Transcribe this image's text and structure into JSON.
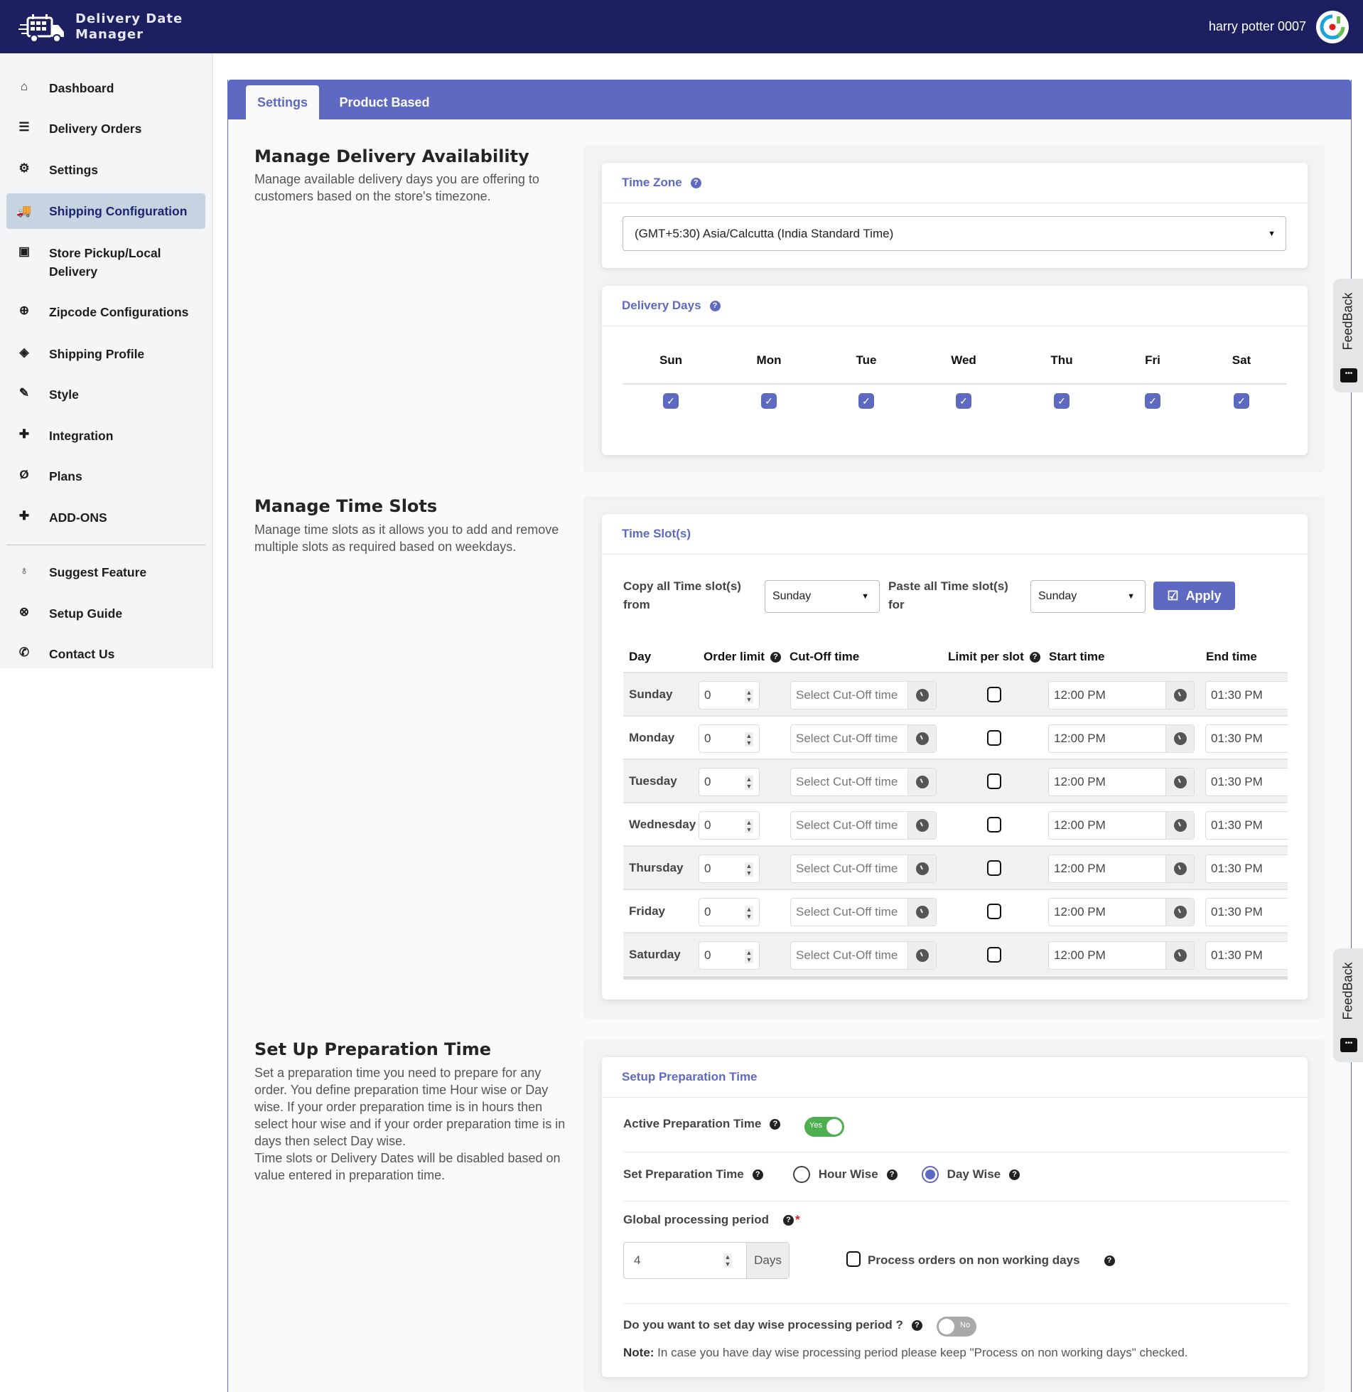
{
  "header": {
    "app_name_line1": "Delivery Date",
    "app_name_line2": "Manager",
    "user_name": "harry potter 0007"
  },
  "sidebar": {
    "items": [
      {
        "label": "Dashboard",
        "icon": "home-icon"
      },
      {
        "label": "Delivery Orders",
        "icon": "list-icon"
      },
      {
        "label": "Settings",
        "icon": "gear-icon"
      },
      {
        "label": "Shipping Configuration",
        "icon": "truck-icon",
        "active": true
      },
      {
        "label": "Store Pickup/Local Delivery",
        "icon": "hand-box-icon"
      },
      {
        "label": "Zipcode Configurations",
        "icon": "map-pin-plus-icon"
      },
      {
        "label": "Shipping Profile",
        "icon": "box-gear-icon"
      },
      {
        "label": "Style",
        "icon": "eyedropper-icon"
      },
      {
        "label": "Integration",
        "icon": "puzzle-icon"
      },
      {
        "label": "Plans",
        "icon": "plans-icon"
      },
      {
        "label": "ADD-ONS",
        "icon": "plus-icon"
      }
    ],
    "secondary_items": [
      {
        "label": "Suggest Feature",
        "icon": "lightbulb-icon"
      },
      {
        "label": "Setup Guide",
        "icon": "lifebuoy-icon"
      },
      {
        "label": "Contact Us",
        "icon": "phone-icon"
      }
    ]
  },
  "tabs": [
    {
      "label": "Settings",
      "active": true
    },
    {
      "label": "Product Based",
      "active": false
    }
  ],
  "availability": {
    "title": "Manage Delivery Availability",
    "description": "Manage available delivery days you are offering to customers based on the store's timezone.",
    "timezone": {
      "title": "Time Zone",
      "value": "(GMT+5:30) Asia/Calcutta (India Standard Time)"
    },
    "delivery_days": {
      "title": "Delivery Days",
      "days": [
        {
          "label": "Sun",
          "checked": true
        },
        {
          "label": "Mon",
          "checked": true
        },
        {
          "label": "Tue",
          "checked": true
        },
        {
          "label": "Wed",
          "checked": true
        },
        {
          "label": "Thu",
          "checked": true
        },
        {
          "label": "Fri",
          "checked": true
        },
        {
          "label": "Sat",
          "checked": true
        }
      ]
    }
  },
  "time_slots": {
    "title": "Manage Time Slots",
    "description": "Manage time slots as it allows you to add and remove multiple slots as required based on weekdays.",
    "card_title": "Time Slot(s)",
    "copy_label_1": "Copy all Time slot(s)",
    "copy_label_2": "from",
    "copy_value": "Sunday",
    "paste_label_1": "Paste all Time slot(s)",
    "paste_label_2": "for",
    "paste_value": "Sunday",
    "apply_label": "Apply",
    "columns": {
      "day": "Day",
      "order_limit": "Order limit",
      "cutoff": "Cut-Off time",
      "limit_per_slot": "Limit per slot",
      "start": "Start time",
      "end": "End time"
    },
    "cutoff_placeholder": "Select Cut-Off time",
    "rows": [
      {
        "day": "Sunday",
        "order_limit": "0",
        "limit_per_slot": false,
        "start": "12:00 PM",
        "end": "01:30 PM"
      },
      {
        "day": "Monday",
        "order_limit": "0",
        "limit_per_slot": false,
        "start": "12:00 PM",
        "end": "01:30 PM"
      },
      {
        "day": "Tuesday",
        "order_limit": "0",
        "limit_per_slot": false,
        "start": "12:00 PM",
        "end": "01:30 PM"
      },
      {
        "day": "Wednesday",
        "order_limit": "0",
        "limit_per_slot": false,
        "start": "12:00 PM",
        "end": "01:30 PM"
      },
      {
        "day": "Thursday",
        "order_limit": "0",
        "limit_per_slot": false,
        "start": "12:00 PM",
        "end": "01:30 PM"
      },
      {
        "day": "Friday",
        "order_limit": "0",
        "limit_per_slot": false,
        "start": "12:00 PM",
        "end": "01:30 PM"
      },
      {
        "day": "Saturday",
        "order_limit": "0",
        "limit_per_slot": false,
        "start": "12:00 PM",
        "end": "01:30 PM"
      }
    ]
  },
  "preparation": {
    "title": "Set Up Preparation Time",
    "description_1": "Set a preparation time you need to prepare for any order. You define preparation time Hour wise or Day wise. If your order preparation time is in hours then select hour wise and if your order preparation time is in days then select Day wise.",
    "description_2": "Time slots or Delivery Dates will be disabled based on value entered in preparation time.",
    "card_title": "Setup Preparation Time",
    "active_label": "Active Preparation Time",
    "active_toggle": "Yes",
    "set_label": "Set Preparation Time",
    "hour_wise": "Hour Wise",
    "day_wise": "Day Wise",
    "selected_mode": "Day Wise",
    "global_label": "Global processing period",
    "required_mark": "*",
    "global_value": "4",
    "global_unit": "Days",
    "non_working_label": "Process orders on non working days",
    "non_working_checked": false,
    "daywise_label": "Do you want to set day wise processing period ?",
    "daywise_toggle": "No",
    "note_bold": "Note:",
    "note_text": " In case you have day wise processing period please keep \"Process on non working days\" checked."
  },
  "feedback_label": "FeedBack",
  "colors": {
    "header_bg": "#1c2060",
    "accent": "#5e69c2",
    "toggle_on": "#4caf50",
    "toggle_off": "#a9a9a9",
    "sidebar_active": "#c6d4e1"
  }
}
